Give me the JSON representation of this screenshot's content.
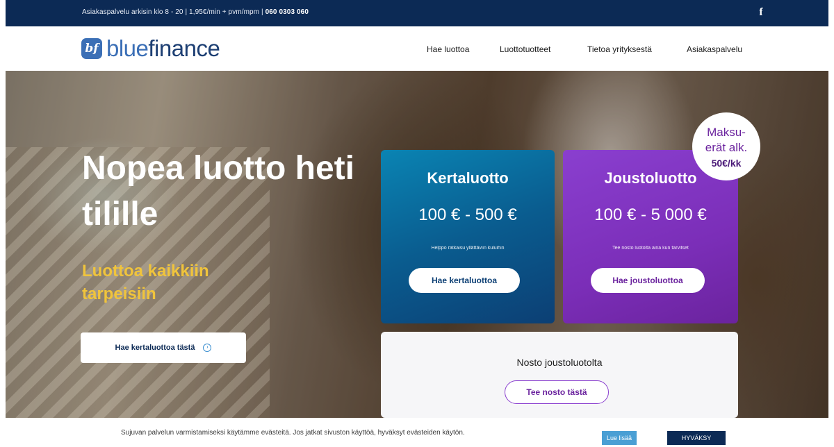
{
  "topbar": {
    "info_text": "Asiakaspalvelu arkisin klo 8 - 20 | 1,95€/min + pvm/mpm | ",
    "phone": "060 0303 060",
    "facebook_icon": "f"
  },
  "header": {
    "logo_mark": "bf",
    "logo_text_blue": "blue",
    "logo_text_dark": "finance",
    "nav": [
      {
        "label": "Hae luottoa"
      },
      {
        "label": "Luottotuotteet"
      },
      {
        "label": "Tietoa yrityksestä"
      },
      {
        "label": "Asiakaspalvelu"
      }
    ]
  },
  "hero": {
    "title": "Nopea luotto heti tilille",
    "subtitle": "Luottoa kaikkiin tarpeisiin",
    "cta_label": "Hae kertaluottoa tästä",
    "cta_icon": "arrow-right-circle-icon"
  },
  "cards": {
    "kerta": {
      "title": "Kertaluotto",
      "range": "100 € - 500 €",
      "desc": "Helppo ratkaisu yllättäviin kuluihin",
      "button": "Hae kertaluottoa"
    },
    "jousto": {
      "title": "Joustoluotto",
      "range": "100 € - 5 000 €",
      "desc": "Tee nosto luotolta aina kun tarvitset",
      "button": "Hae joustoluottoa"
    },
    "badge": {
      "line1": "Maksu-",
      "line2": "erät alk.",
      "line3": "50€/kk"
    },
    "nosto": {
      "title": "Nosto joustoluotolta",
      "button": "Tee nosto tästä"
    }
  },
  "cookie": {
    "text": "Sujuvan palvelun varmistamiseksi käytämme evästeitä. Jos jatkat sivuston käyttöä, hyväksyt evästeiden käytön.",
    "more": "Lue lisää",
    "accept": "HYVÄKSY"
  },
  "colors": {
    "navy": "#0c2a55",
    "brand_blue": "#3b6fb6",
    "kerta_card": "#0a5c8f",
    "jousto_card": "#7b2eb8",
    "hero_yellow": "#f0c43c"
  }
}
